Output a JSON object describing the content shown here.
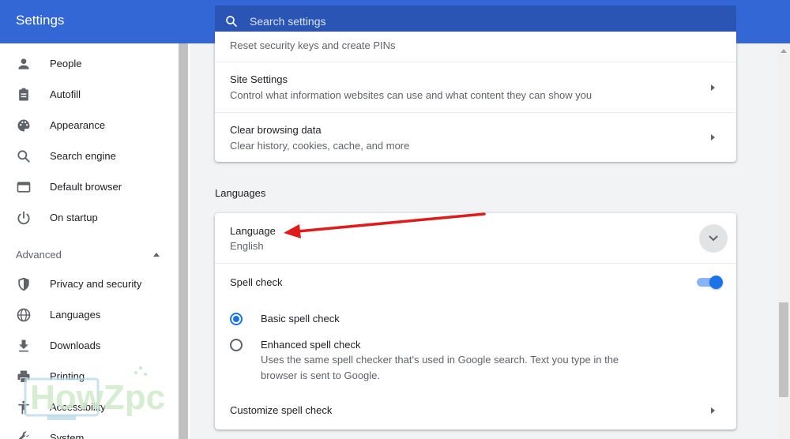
{
  "header": {
    "title": "Settings",
    "search_placeholder": "Search settings"
  },
  "sidebar": {
    "items": [
      {
        "label": "People",
        "icon": "person-icon"
      },
      {
        "label": "Autofill",
        "icon": "clipboard-icon"
      },
      {
        "label": "Appearance",
        "icon": "palette-icon"
      },
      {
        "label": "Search engine",
        "icon": "search-icon"
      },
      {
        "label": "Default browser",
        "icon": "browser-icon"
      },
      {
        "label": "On startup",
        "icon": "power-icon"
      }
    ],
    "advanced_label": "Advanced",
    "advanced_items": [
      {
        "label": "Privacy and security",
        "icon": "shield-icon"
      },
      {
        "label": "Languages",
        "icon": "globe-icon"
      },
      {
        "label": "Downloads",
        "icon": "download-icon"
      },
      {
        "label": "Printing",
        "icon": "printer-icon"
      },
      {
        "label": "Accessibility",
        "icon": "accessibility-icon"
      },
      {
        "label": "System",
        "icon": "wrench-icon"
      }
    ]
  },
  "privacy_card": {
    "truncated_text": "Reset security keys and create PINs",
    "rows": [
      {
        "title": "Site Settings",
        "subtitle": "Control what information websites can use and what content they can show you"
      },
      {
        "title": "Clear browsing data",
        "subtitle": "Clear history, cookies, cache, and more"
      }
    ]
  },
  "languages": {
    "section_title": "Languages",
    "language_title": "Language",
    "language_value": "English",
    "spell_check_label": "Spell check",
    "spell_check_enabled": true,
    "basic_label": "Basic spell check",
    "enhanced_label": "Enhanced spell check",
    "enhanced_desc_line1": "Uses the same spell checker that's used in Google search. Text you type in the",
    "enhanced_desc_line2": "browser is sent to Google.",
    "customize_label": "Customize spell check"
  },
  "watermark": {
    "text": "HowZpc"
  },
  "colors": {
    "header": "#3367d6",
    "accent": "#1a73e8",
    "annotation_arrow": "#e01b1b"
  }
}
